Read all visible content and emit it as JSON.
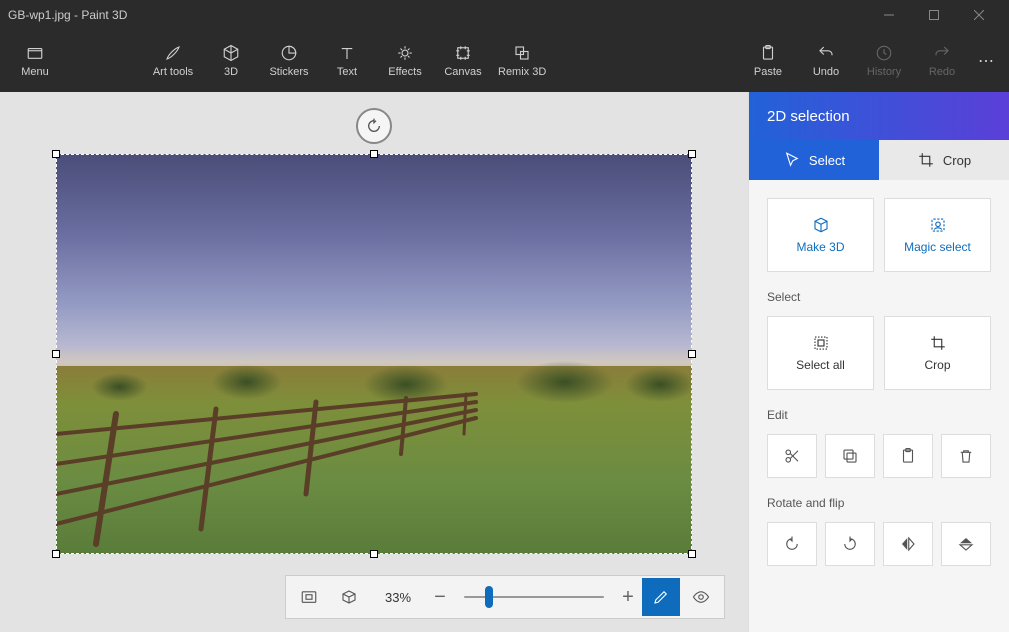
{
  "window": {
    "title": "GB-wp1.jpg - Paint 3D"
  },
  "ribbon": {
    "menu": "Menu",
    "art_tools": "Art tools",
    "three_d": "3D",
    "stickers": "Stickers",
    "text": "Text",
    "effects": "Effects",
    "canvas": "Canvas",
    "remix": "Remix 3D",
    "paste": "Paste",
    "undo": "Undo",
    "history": "History",
    "redo": "Redo"
  },
  "bottombar": {
    "zoom": "33%"
  },
  "panel": {
    "header": "2D selection",
    "tab_select": "Select",
    "tab_crop": "Crop",
    "make_3d": "Make 3D",
    "magic_select": "Magic select",
    "section_select": "Select",
    "select_all": "Select all",
    "crop": "Crop",
    "section_edit": "Edit",
    "section_rotate": "Rotate and flip"
  },
  "colors": {
    "accent": "#0f6cbd"
  }
}
